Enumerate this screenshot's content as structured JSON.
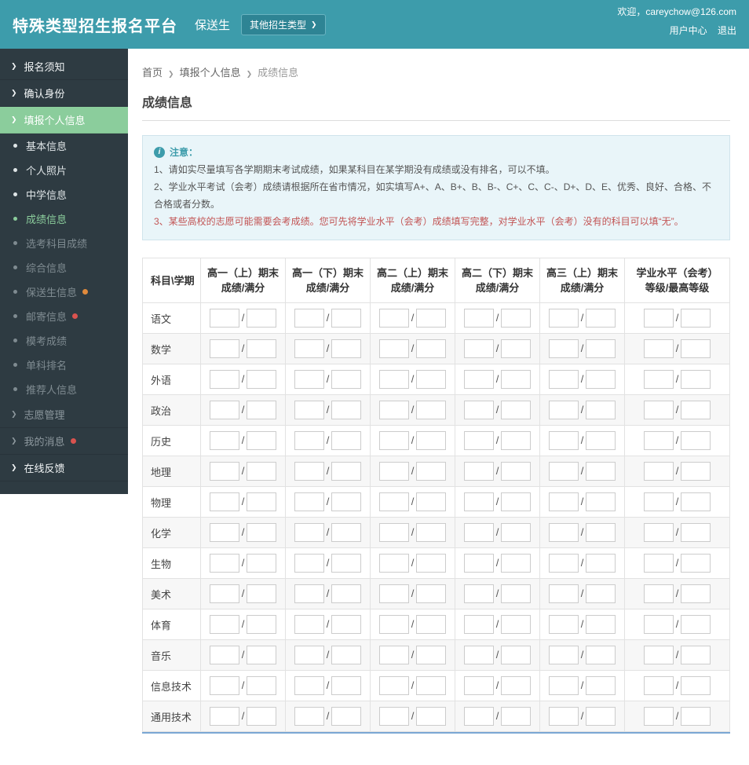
{
  "header": {
    "title": "特殊类型招生报名平台",
    "subtitle": "保送生",
    "other_types_button": "其他招生类型",
    "welcome": "欢迎，careychow@126.com",
    "user_center": "用户中心",
    "logout": "退出"
  },
  "sidebar": {
    "items": [
      {
        "label": "报名须知",
        "type": "top",
        "state": "normal"
      },
      {
        "label": "确认身份",
        "type": "top",
        "state": "normal"
      },
      {
        "label": "填报个人信息",
        "type": "top",
        "state": "active"
      },
      {
        "label": "基本信息",
        "type": "sub",
        "state": "done"
      },
      {
        "label": "个人照片",
        "type": "sub",
        "state": "done"
      },
      {
        "label": "中学信息",
        "type": "sub",
        "state": "done"
      },
      {
        "label": "成绩信息",
        "type": "sub",
        "state": "current"
      },
      {
        "label": "选考科目成绩",
        "type": "sub",
        "state": "pending"
      },
      {
        "label": "综合信息",
        "type": "sub",
        "state": "pending"
      },
      {
        "label": "保送生信息",
        "type": "sub",
        "state": "pending",
        "dot": "orange"
      },
      {
        "label": "邮寄信息",
        "type": "sub",
        "state": "pending",
        "dot": "red"
      },
      {
        "label": "模考成绩",
        "type": "sub",
        "state": "pending"
      },
      {
        "label": "单科排名",
        "type": "sub",
        "state": "pending"
      },
      {
        "label": "推荐人信息",
        "type": "sub",
        "state": "pending"
      },
      {
        "label": "志愿管理",
        "type": "top",
        "state": "dim"
      },
      {
        "label": "我的消息",
        "type": "top",
        "state": "dim",
        "dot": "red"
      },
      {
        "label": "在线反馈",
        "type": "top",
        "state": "normal"
      }
    ]
  },
  "breadcrumb": [
    "首页",
    "填报个人信息",
    "成绩信息"
  ],
  "page": {
    "title": "成绩信息"
  },
  "notice": {
    "title": "注意：",
    "lines": [
      {
        "text": "1、请如实尽量填写各学期期末考试成绩，如果某科目在某学期没有成绩或没有排名，可以不填。",
        "highlight": false
      },
      {
        "text": "2、学业水平考试（会考）成绩请根据所在省市情况，如实填写A+、A、B+、B、B-、C+、C、C-、D+、D、E、优秀、良好、合格、不合格或者分数。",
        "highlight": false
      },
      {
        "text": "3、某些高校的志愿可能需要会考成绩。您可先将学业水平（会考）成绩填写完整，对学业水平（会考）没有的科目可以填“无”。",
        "highlight": true
      }
    ]
  },
  "table": {
    "corner": "科目\\学期",
    "columns": [
      {
        "line1": "高一（上）期末",
        "line2": "成绩/满分"
      },
      {
        "line1": "高一（下）期末",
        "line2": "成绩/满分"
      },
      {
        "line1": "高二（上）期末",
        "line2": "成绩/满分"
      },
      {
        "line1": "高二（下）期末",
        "line2": "成绩/满分"
      },
      {
        "line1": "高三（上）期末",
        "line2": "成绩/满分"
      },
      {
        "line1": "学业水平（会考）",
        "line2": "等级/最高等级"
      }
    ],
    "subjects": [
      "语文",
      "数学",
      "外语",
      "政治",
      "历史",
      "地理",
      "物理",
      "化学",
      "生物",
      "美术",
      "体育",
      "音乐",
      "信息技术",
      "通用技术"
    ],
    "input_value": "",
    "separator": "/"
  },
  "colors": {
    "header_bg": "#3d9cab",
    "sidebar_bg": "#2e3b42",
    "active_green": "#8bcd9c",
    "notice_bg": "#e9f5f9",
    "highlight_red": "#c25454"
  }
}
